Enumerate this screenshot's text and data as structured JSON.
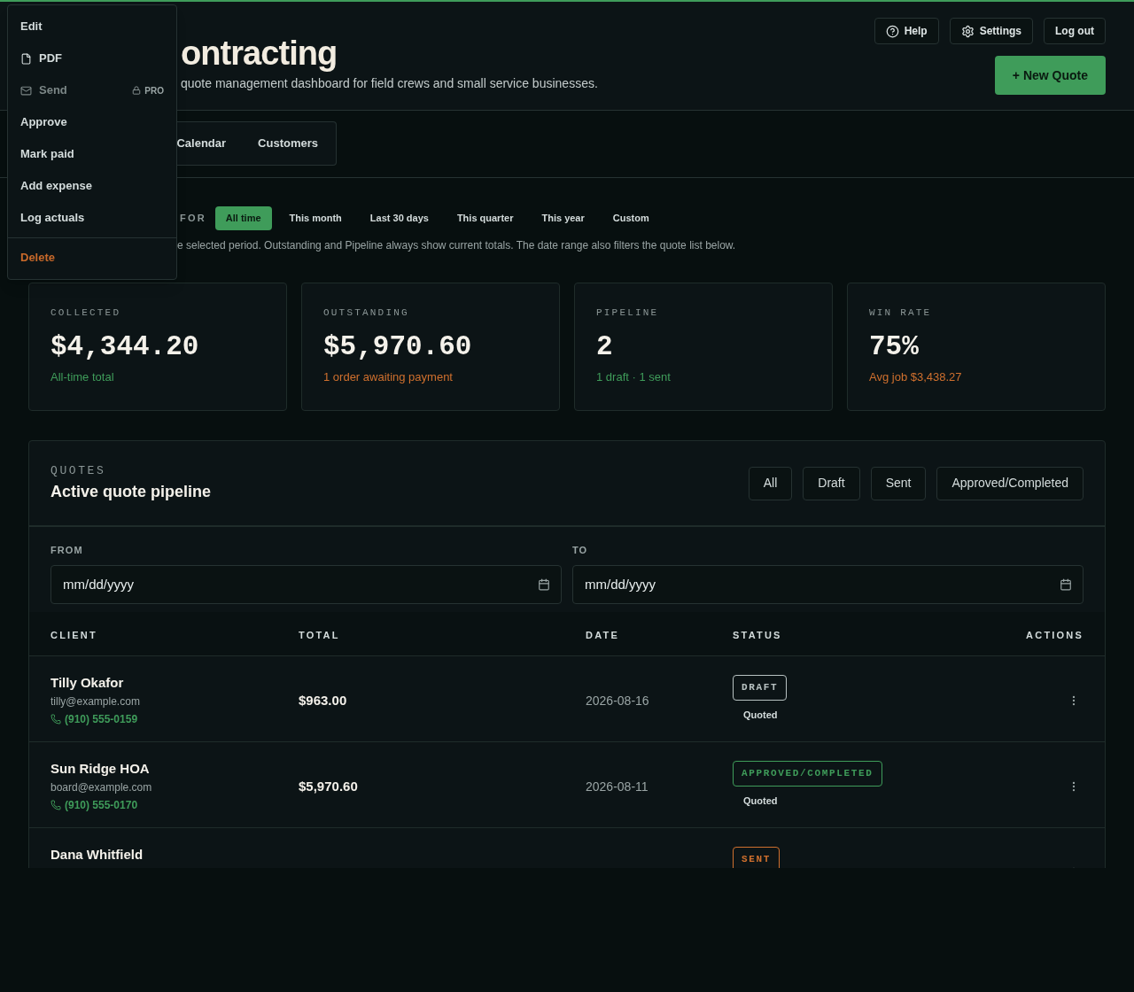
{
  "header": {
    "title": "ontracting",
    "subtitle": "quote management dashboard for field crews and small service businesses.",
    "buttons": [
      {
        "label": "Help",
        "kind": "help"
      },
      {
        "label": "Settings",
        "kind": "settings"
      },
      {
        "label": "Log out",
        "kind": "plain"
      }
    ],
    "primary_button": "+ New Quote"
  },
  "nav_tabs": [
    {
      "label": "Calendar",
      "selected": false
    },
    {
      "label": "Customers",
      "selected": false
    }
  ],
  "period": {
    "label": "FOR",
    "options": [
      {
        "label": "All time",
        "selected": true
      },
      {
        "label": "This month",
        "selected": false
      },
      {
        "label": "Last 30 days",
        "selected": false
      },
      {
        "label": "This quarter",
        "selected": false
      },
      {
        "label": "This year",
        "selected": false
      },
      {
        "label": "Custom",
        "selected": false
      }
    ],
    "note": "e selected period. Outstanding and Pipeline always show current totals. The date range also filters the quote list below."
  },
  "stats": [
    {
      "label": "COLLECTED",
      "value": "$4,344.20",
      "note": "All-time total",
      "color": "#3f9c5a"
    },
    {
      "label": "OUTSTANDING",
      "value": "$5,970.60",
      "note": "1 order awaiting payment",
      "color": "#d0702e"
    },
    {
      "label": "PIPELINE",
      "value": "2",
      "note": "1 draft · 1 sent",
      "color": "#3f9c5a"
    },
    {
      "label": "WIN RATE",
      "value": "75%",
      "note": "Avg job $3,438.27",
      "color": "#d0702e"
    }
  ],
  "quotes": {
    "eyebrow": "QUOTES",
    "title": "Active quote pipeline",
    "filters": [
      "All",
      "Draft",
      "Sent",
      "Approved/Completed"
    ],
    "from": {
      "label": "FROM",
      "placeholder": "mm/dd/yyyy"
    },
    "to": {
      "label": "TO",
      "placeholder": "mm/dd/yyyy"
    },
    "columns": [
      "CLIENT",
      "TOTAL",
      "DATE",
      "STATUS",
      "ACTIONS"
    ],
    "rows": [
      {
        "client": "Tilly Okafor",
        "email": "tilly@example.com",
        "phone": "(910) 555-0159",
        "total": "$963.00",
        "date": "2026-08-16",
        "status": "DRAFT",
        "color": "#b8c2c2",
        "sub": "Quoted"
      },
      {
        "client": "Sun Ridge HOA",
        "email": "board@example.com",
        "phone": "(910) 555-0170",
        "total": "$5,970.60",
        "date": "2026-08-11",
        "status": "APPROVED/COMPLETED",
        "color": "#3f9c5a",
        "sub": "Quoted"
      },
      {
        "client": "Dana Whitfield",
        "status": "SENT",
        "color": "#d0702e"
      }
    ]
  },
  "menu": [
    {
      "label": "Edit",
      "kind": "text",
      "disabled": false
    },
    {
      "label": "PDF",
      "kind": "file",
      "disabled": false
    },
    {
      "label": "Send",
      "kind": "mail",
      "disabled": true,
      "badge": "PRO"
    },
    {
      "label": "Approve",
      "kind": "text",
      "disabled": false
    },
    {
      "label": "Mark paid",
      "kind": "text",
      "disabled": false
    },
    {
      "label": "Add expense",
      "kind": "text",
      "disabled": false
    },
    {
      "label": "Log actuals",
      "kind": "text",
      "disabled": false
    },
    {
      "label": "Delete",
      "kind": "danger",
      "disabled": false
    }
  ]
}
